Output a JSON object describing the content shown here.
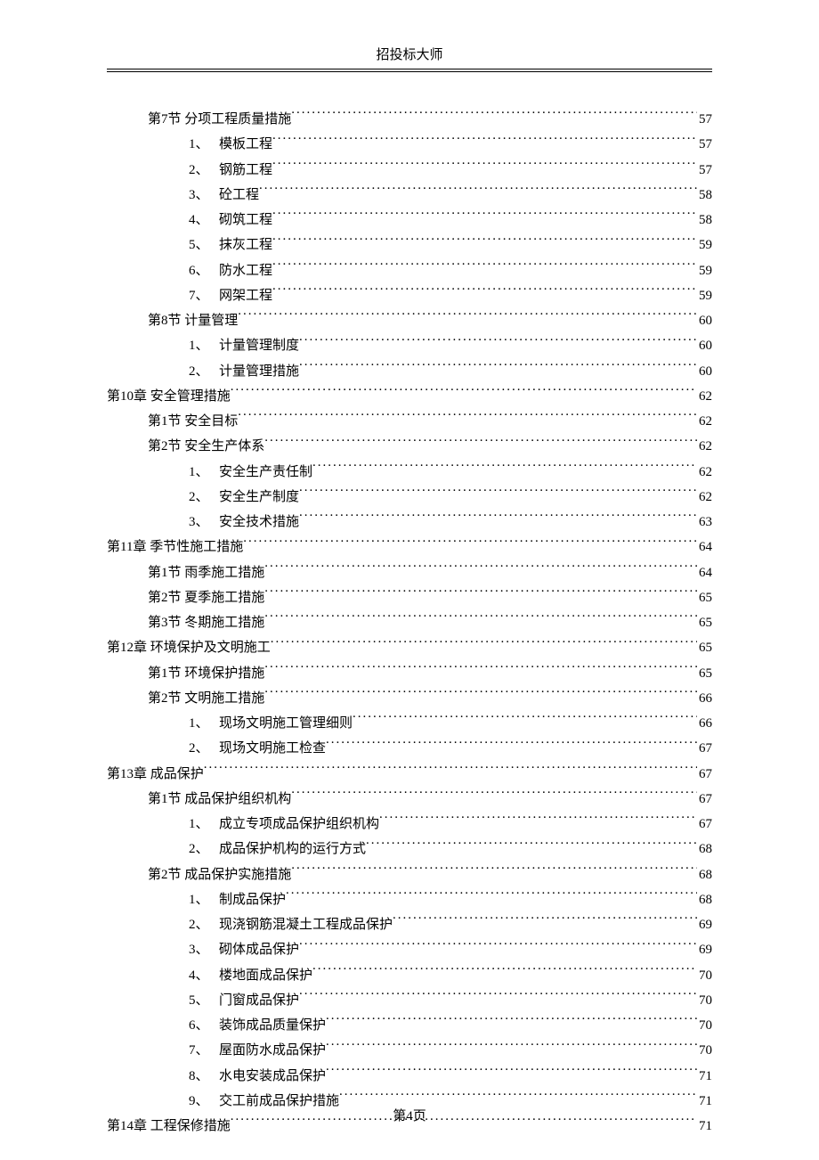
{
  "header": {
    "title": "招投标大师"
  },
  "footer": {
    "page_label": "第4页"
  },
  "toc": [
    {
      "level": 1,
      "label": "第7节 分项工程质量措施",
      "page": "57"
    },
    {
      "level": 2,
      "marker": "1、",
      "label": "模板工程",
      "page": "57"
    },
    {
      "level": 2,
      "marker": "2、",
      "label": "钢筋工程",
      "page": "57"
    },
    {
      "level": 2,
      "marker": "3、",
      "label": "砼工程",
      "page": "58"
    },
    {
      "level": 2,
      "marker": "4、",
      "label": "砌筑工程",
      "page": "58"
    },
    {
      "level": 2,
      "marker": "5、",
      "label": "抹灰工程",
      "page": "59"
    },
    {
      "level": 2,
      "marker": "6、",
      "label": "防水工程",
      "page": "59"
    },
    {
      "level": 2,
      "marker": "7、",
      "label": "网架工程",
      "page": "59"
    },
    {
      "level": 1,
      "label": "第8节 计量管理",
      "page": "60"
    },
    {
      "level": 2,
      "marker": "1、",
      "label": "计量管理制度",
      "page": "60"
    },
    {
      "level": 2,
      "marker": "2、",
      "label": "计量管理措施",
      "page": "60"
    },
    {
      "level": 0,
      "label": "第10章 安全管理措施",
      "page": "62"
    },
    {
      "level": 1,
      "label": "第1节 安全目标",
      "page": "62"
    },
    {
      "level": 1,
      "label": "第2节 安全生产体系",
      "page": "62"
    },
    {
      "level": 2,
      "marker": "1、",
      "label": "安全生产责任制",
      "page": "62"
    },
    {
      "level": 2,
      "marker": "2、",
      "label": "安全生产制度",
      "page": "62"
    },
    {
      "level": 2,
      "marker": "3、",
      "label": "安全技术措施",
      "page": "63"
    },
    {
      "level": 0,
      "label": "第11章 季节性施工措施",
      "page": "64"
    },
    {
      "level": 1,
      "label": "第1节 雨季施工措施",
      "page": "64"
    },
    {
      "level": 1,
      "label": "第2节 夏季施工措施",
      "page": "65"
    },
    {
      "level": 1,
      "label": "第3节 冬期施工措施",
      "page": "65"
    },
    {
      "level": 0,
      "label": "第12章 环境保护及文明施工",
      "page": "65"
    },
    {
      "level": 1,
      "label": "第1节 环境保护措施",
      "page": "65"
    },
    {
      "level": 1,
      "label": "第2节 文明施工措施",
      "page": "66"
    },
    {
      "level": 2,
      "marker": "1、",
      "label": "现场文明施工管理细则",
      "page": "66"
    },
    {
      "level": 2,
      "marker": "2、",
      "label": "现场文明施工检查",
      "page": "67"
    },
    {
      "level": 0,
      "label": "第13章 成品保护",
      "page": "67"
    },
    {
      "level": 1,
      "label": "第1节 成品保护组织机构",
      "page": "67"
    },
    {
      "level": 2,
      "marker": "1、",
      "label": "成立专项成品保护组织机构",
      "page": "67"
    },
    {
      "level": 2,
      "marker": "2、",
      "label": "成品保护机构的运行方式",
      "page": "68"
    },
    {
      "level": 1,
      "label": "第2节 成品保护实施措施",
      "page": "68"
    },
    {
      "level": 2,
      "marker": "1、",
      "label": "制成品保护",
      "page": "68"
    },
    {
      "level": 2,
      "marker": "2、",
      "label": "现浇钢筋混凝土工程成品保护",
      "page": "69"
    },
    {
      "level": 2,
      "marker": "3、",
      "label": "砌体成品保护",
      "page": "69"
    },
    {
      "level": 2,
      "marker": "4、",
      "label": "楼地面成品保护",
      "page": "70"
    },
    {
      "level": 2,
      "marker": "5、",
      "label": "门窗成品保护",
      "page": "70"
    },
    {
      "level": 2,
      "marker": "6、",
      "label": "装饰成品质量保护",
      "page": "70"
    },
    {
      "level": 2,
      "marker": "7、",
      "label": "屋面防水成品保护",
      "page": "70"
    },
    {
      "level": 2,
      "marker": "8、",
      "label": "水电安装成品保护",
      "page": "71"
    },
    {
      "level": 2,
      "marker": "9、",
      "label": "交工前成品保护措施",
      "page": "71"
    },
    {
      "level": 0,
      "label": "第14章 工程保修措施",
      "page": "71"
    }
  ]
}
